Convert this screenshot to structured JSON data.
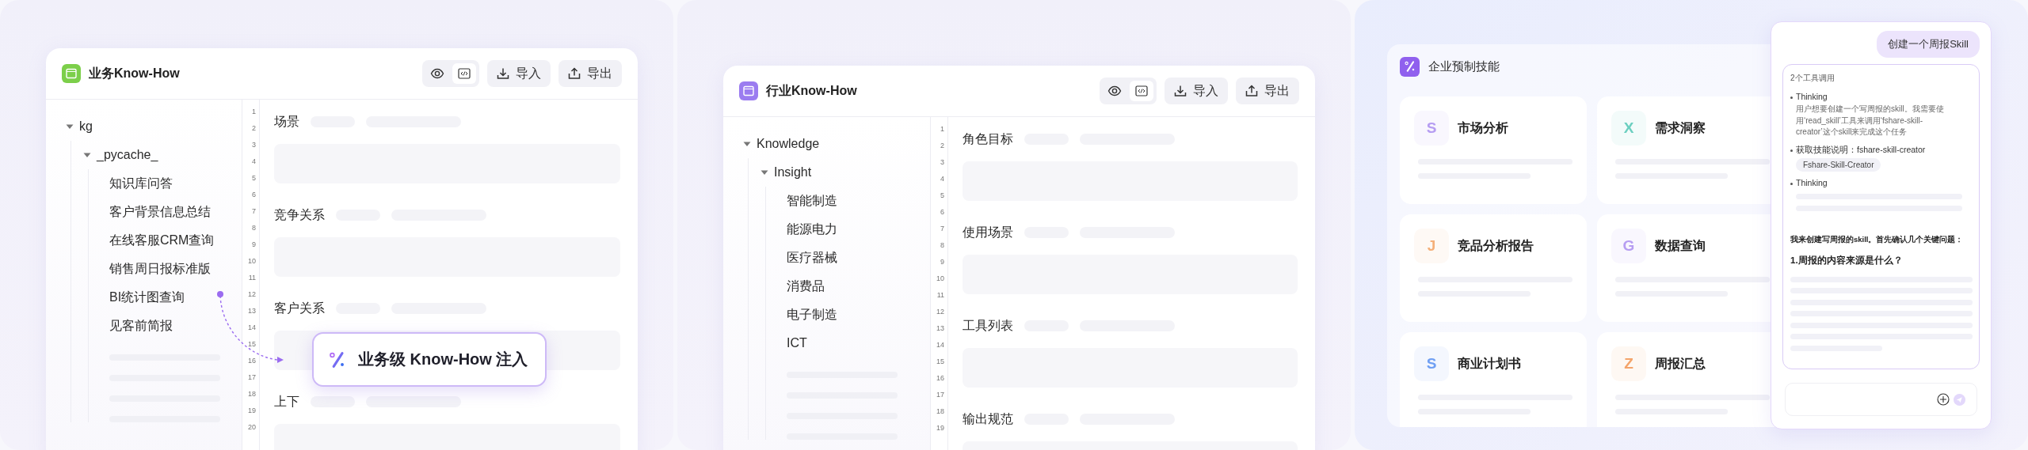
{
  "panels": [
    {
      "kind": "editor",
      "title": "业务Know-How",
      "color": "#7ccf4a",
      "view_modes": [
        {
          "kind": "preview",
          "selected": false
        },
        {
          "kind": "code",
          "selected": true
        }
      ],
      "buttons": [
        {
          "kind": "import",
          "label": "导入"
        },
        {
          "kind": "export",
          "label": "导出"
        }
      ],
      "tree": [
        {
          "label": "kg",
          "expanded": true,
          "children": [
            {
              "label": "_pycache_",
              "expanded": true,
              "children": [
                {
                  "label": "知识库问答"
                },
                {
                  "label": "客户背景信息总结"
                },
                {
                  "label": "在线客服CRM查询"
                },
                {
                  "label": "销售周日报标准版"
                },
                {
                  "label": "BI统计图查询"
                },
                {
                  "label": "见客前简报"
                }
              ]
            }
          ]
        }
      ],
      "line_numbers": [
        "1",
        "2",
        "3",
        "4",
        "5",
        "6",
        "7",
        "8",
        "9",
        "10",
        "11",
        "12",
        "13",
        "14",
        "15",
        "16",
        "17",
        "18",
        "19",
        "20"
      ],
      "sections": [
        "场景",
        "竞争关系",
        "客户关系",
        "上下"
      ],
      "callout": {
        "label": "业务级 Know-How 注入"
      }
    },
    {
      "kind": "editor",
      "title": "行业Know-How",
      "color": "#9b7cf0",
      "view_modes": [
        {
          "kind": "preview",
          "selected": false
        },
        {
          "kind": "code",
          "selected": true
        }
      ],
      "buttons": [
        {
          "kind": "import",
          "label": "导入"
        },
        {
          "kind": "export",
          "label": "导出"
        }
      ],
      "tree": [
        {
          "label": "Knowledge",
          "expanded": true,
          "children": [
            {
              "label": "Insight",
              "expanded": true,
              "children": [
                {
                  "label": "智能制造"
                },
                {
                  "label": "能源电力"
                },
                {
                  "label": "医疗器械"
                },
                {
                  "label": "消费品"
                },
                {
                  "label": "电子制造"
                },
                {
                  "label": "ICT"
                }
              ]
            }
          ]
        }
      ],
      "line_numbers": [
        "1",
        "2",
        "3",
        "4",
        "5",
        "6",
        "7",
        "8",
        "9",
        "10",
        "11",
        "12",
        "13",
        "14",
        "15",
        "16",
        "17",
        "18",
        "19"
      ],
      "sections": [
        "角色目标",
        "使用场景",
        "工具列表",
        "输出规范"
      ]
    },
    {
      "kind": "skills",
      "title": "企业预制技能",
      "skills": [
        {
          "letter": "S",
          "name": "市场分析",
          "color": "#b69df2"
        },
        {
          "letter": "X",
          "name": "需求洞察",
          "color": "#6ccfc0"
        },
        {
          "letter": "J",
          "name": "竞品分析报告",
          "color": "#f4b07a"
        },
        {
          "letter": "G",
          "name": "数据查询",
          "color": "#b69df2"
        },
        {
          "letter": "S",
          "name": "商业计划书",
          "color": "#6f9ff3"
        },
        {
          "letter": "Z",
          "name": "周报汇总",
          "color": "#f4a46a"
        }
      ],
      "chat": {
        "user_message": "创建一个周报Skill",
        "tool_header": "2个工具调用",
        "steps": [
          {
            "kind": "thinking",
            "title": "Thinking",
            "text": "用户想要创建一个写周报的skill。我需要使用‘read_skill’工具来调用‘fshare-skill-creator’这个skill来完成这个任务"
          },
          {
            "kind": "tool",
            "title": "获取技能说明：fshare-skill-creator",
            "tag": "Fshare-Skill-Creator"
          },
          {
            "kind": "pending",
            "title": "Thinking"
          }
        ],
        "answer": "我来创建写周报的skill。首先确认几个关键问题：",
        "question": "1.周报的内容来源是什么？"
      }
    }
  ]
}
